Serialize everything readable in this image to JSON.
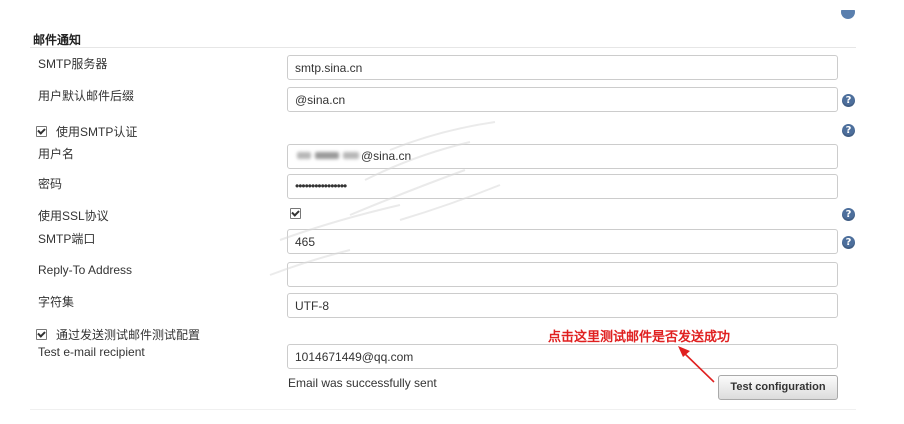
{
  "section": {
    "title": "邮件通知"
  },
  "icons": {
    "help": "?",
    "help_icon_name": "help-circle-icon",
    "arrow_icon_name": "red-arrow-icon",
    "accent_color": "#4d6f9c",
    "annotation_color": "#e02020"
  },
  "smtp_server": {
    "label": "SMTP服务器",
    "value": "smtp.sina.cn"
  },
  "default_suffix": {
    "label": "用户默认邮件后缀",
    "value": "@sina.cn"
  },
  "smtp_auth": {
    "label": "使用SMTP认证",
    "checked": true
  },
  "username": {
    "label": "用户名",
    "value_suffix": "@sina.cn"
  },
  "password": {
    "label": "密码",
    "value": "••••••••••••••••"
  },
  "ssl": {
    "label": "使用SSL协议",
    "checked": true
  },
  "smtp_port": {
    "label": "SMTP端口",
    "value": "465"
  },
  "reply_to": {
    "label": "Reply-To Address",
    "value": ""
  },
  "charset": {
    "label": "字符集",
    "value": "UTF-8"
  },
  "test_config": {
    "label": "通过发送测试邮件测试配置",
    "checked": true
  },
  "test_recipient": {
    "label": "Test e-mail recipient",
    "value": "1014671449@qq.com"
  },
  "status": {
    "message": "Email was successfully sent"
  },
  "button": {
    "test_label": "Test configuration"
  },
  "annotation": {
    "text": "点击这里测试邮件是否发送成功"
  }
}
